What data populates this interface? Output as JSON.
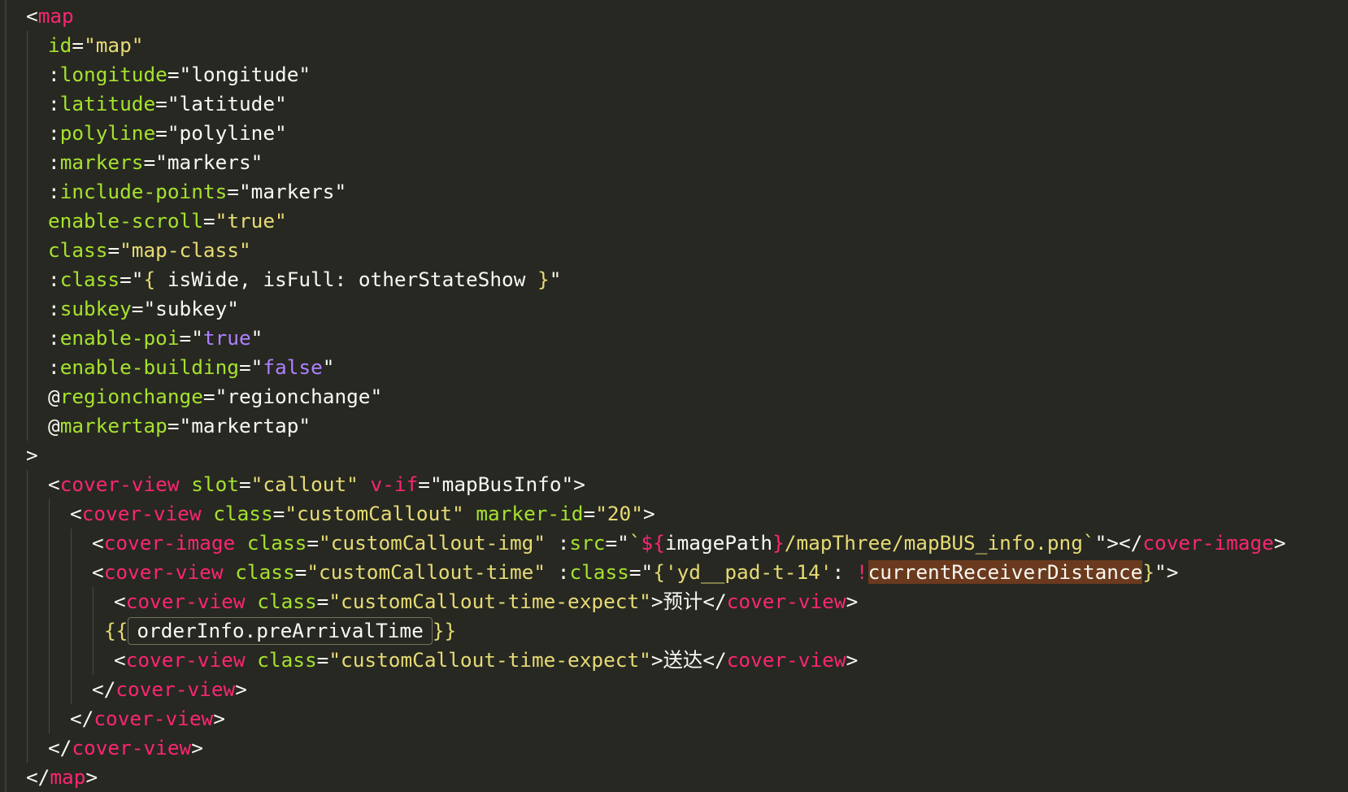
{
  "lines": [
    {
      "indent": 1,
      "guides": 0,
      "tokens": [
        [
          "punc",
          "<"
        ],
        [
          "tag",
          "map"
        ]
      ]
    },
    {
      "indent": 2,
      "guides": 1,
      "tokens": [
        [
          "attr",
          "id"
        ],
        [
          "punc",
          "="
        ],
        [
          "str",
          "\"map\""
        ]
      ]
    },
    {
      "indent": 2,
      "guides": 1,
      "tokens": [
        [
          "punc",
          ":"
        ],
        [
          "attr",
          "longitude"
        ],
        [
          "punc",
          "=\""
        ],
        [
          "plain",
          "longitude"
        ],
        [
          "punc",
          "\""
        ]
      ]
    },
    {
      "indent": 2,
      "guides": 1,
      "tokens": [
        [
          "punc",
          ":"
        ],
        [
          "attr",
          "latitude"
        ],
        [
          "punc",
          "=\""
        ],
        [
          "plain",
          "latitude"
        ],
        [
          "punc",
          "\""
        ]
      ]
    },
    {
      "indent": 2,
      "guides": 1,
      "tokens": [
        [
          "punc",
          ":"
        ],
        [
          "attr",
          "polyline"
        ],
        [
          "punc",
          "=\""
        ],
        [
          "plain",
          "polyline"
        ],
        [
          "punc",
          "\""
        ]
      ]
    },
    {
      "indent": 2,
      "guides": 1,
      "tokens": [
        [
          "punc",
          ":"
        ],
        [
          "attr",
          "markers"
        ],
        [
          "punc",
          "=\""
        ],
        [
          "plain",
          "markers"
        ],
        [
          "punc",
          "\""
        ]
      ]
    },
    {
      "indent": 2,
      "guides": 1,
      "tokens": [
        [
          "punc",
          ":"
        ],
        [
          "attr",
          "include-points"
        ],
        [
          "punc",
          "=\""
        ],
        [
          "plain",
          "markers"
        ],
        [
          "punc",
          "\""
        ]
      ]
    },
    {
      "indent": 2,
      "guides": 1,
      "tokens": [
        [
          "attr",
          "enable-scroll"
        ],
        [
          "punc",
          "="
        ],
        [
          "str",
          "\"true\""
        ]
      ]
    },
    {
      "indent": 2,
      "guides": 1,
      "tokens": [
        [
          "attr",
          "class"
        ],
        [
          "punc",
          "="
        ],
        [
          "str",
          "\"map-class\""
        ]
      ]
    },
    {
      "indent": 2,
      "guides": 1,
      "tokens": [
        [
          "punc",
          ":"
        ],
        [
          "attr",
          "class"
        ],
        [
          "punc",
          "=\""
        ],
        [
          "brace",
          "{"
        ],
        [
          "plain",
          " isWide, isFull: otherStateShow "
        ],
        [
          "brace",
          "}"
        ],
        [
          "punc",
          "\""
        ]
      ]
    },
    {
      "indent": 2,
      "guides": 1,
      "tokens": [
        [
          "punc",
          ":"
        ],
        [
          "attr",
          "subkey"
        ],
        [
          "punc",
          "=\""
        ],
        [
          "plain",
          "subkey"
        ],
        [
          "punc",
          "\""
        ]
      ]
    },
    {
      "indent": 2,
      "guides": 1,
      "tokens": [
        [
          "punc",
          ":"
        ],
        [
          "attr",
          "enable-poi"
        ],
        [
          "punc",
          "=\""
        ],
        [
          "bool",
          "true"
        ],
        [
          "punc",
          "\""
        ]
      ]
    },
    {
      "indent": 2,
      "guides": 1,
      "tokens": [
        [
          "punc",
          ":"
        ],
        [
          "attr",
          "enable-building"
        ],
        [
          "punc",
          "=\""
        ],
        [
          "bool",
          "false"
        ],
        [
          "punc",
          "\""
        ]
      ]
    },
    {
      "indent": 2,
      "guides": 1,
      "tokens": [
        [
          "punc",
          "@"
        ],
        [
          "attr",
          "regionchange"
        ],
        [
          "punc",
          "=\""
        ],
        [
          "plain",
          "regionchange"
        ],
        [
          "punc",
          "\""
        ]
      ]
    },
    {
      "indent": 2,
      "guides": 1,
      "tokens": [
        [
          "punc",
          "@"
        ],
        [
          "attr",
          "markertap"
        ],
        [
          "punc",
          "=\""
        ],
        [
          "plain",
          "markertap"
        ],
        [
          "punc",
          "\""
        ]
      ]
    },
    {
      "indent": 1,
      "guides": 0,
      "tokens": [
        [
          "punc",
          ">"
        ]
      ]
    },
    {
      "indent": 2,
      "guides": 1,
      "tokens": [
        [
          "punc",
          "<"
        ],
        [
          "tag",
          "cover-view"
        ],
        [
          "plain",
          " "
        ],
        [
          "attr",
          "slot"
        ],
        [
          "punc",
          "="
        ],
        [
          "str",
          "\"callout\""
        ],
        [
          "plain",
          " "
        ],
        [
          "tag",
          "v-if"
        ],
        [
          "punc",
          "=\""
        ],
        [
          "plain",
          "mapBusInfo"
        ],
        [
          "punc",
          "\">"
        ]
      ]
    },
    {
      "indent": 3,
      "guides": 2,
      "tokens": [
        [
          "punc",
          "<"
        ],
        [
          "tag",
          "cover-view"
        ],
        [
          "plain",
          " "
        ],
        [
          "attr",
          "class"
        ],
        [
          "punc",
          "="
        ],
        [
          "str",
          "\"customCallout\""
        ],
        [
          "plain",
          " "
        ],
        [
          "attr",
          "marker-id"
        ],
        [
          "punc",
          "="
        ],
        [
          "str",
          "\"20\""
        ],
        [
          "punc",
          ">"
        ]
      ]
    },
    {
      "indent": 4,
      "guides": 3,
      "tokens": [
        [
          "punc",
          "<"
        ],
        [
          "tag",
          "cover-image"
        ],
        [
          "plain",
          " "
        ],
        [
          "attr",
          "class"
        ],
        [
          "punc",
          "="
        ],
        [
          "str",
          "\"customCallout-img\""
        ],
        [
          "plain",
          " "
        ],
        [
          "punc",
          ":"
        ],
        [
          "attr",
          "src"
        ],
        [
          "punc",
          "=\""
        ],
        [
          "str",
          "`"
        ],
        [
          "tag",
          "${"
        ],
        [
          "plain",
          "imagePath"
        ],
        [
          "tag",
          "}"
        ],
        [
          "str",
          "/mapThree/mapBUS_info.png`"
        ],
        [
          "punc",
          "\"></"
        ],
        [
          "tag",
          "cover-image"
        ],
        [
          "punc",
          ">"
        ]
      ]
    },
    {
      "indent": 4,
      "guides": 3,
      "tokens": [
        [
          "punc",
          "<"
        ],
        [
          "tag",
          "cover-view"
        ],
        [
          "plain",
          " "
        ],
        [
          "attr",
          "class"
        ],
        [
          "punc",
          "="
        ],
        [
          "str",
          "\"customCallout-time\""
        ],
        [
          "plain",
          " "
        ],
        [
          "punc",
          ":"
        ],
        [
          "attr",
          "class"
        ],
        [
          "punc",
          "=\""
        ],
        [
          "brace",
          "{"
        ],
        [
          "str",
          "'yd__pad-t-14'"
        ],
        [
          "plain",
          ": "
        ],
        [
          "tag",
          "!"
        ],
        [
          "hl",
          "currentReceiverDistance"
        ],
        [
          "brace",
          "}"
        ],
        [
          "punc",
          "\">"
        ]
      ]
    },
    {
      "indent": 5,
      "guides": 4,
      "tokens": [
        [
          "punc",
          "<"
        ],
        [
          "tag",
          "cover-view"
        ],
        [
          "plain",
          " "
        ],
        [
          "attr",
          "class"
        ],
        [
          "punc",
          "="
        ],
        [
          "str",
          "\"customCallout-time-expect\""
        ],
        [
          "punc",
          ">"
        ],
        [
          "cjk",
          "预计"
        ],
        [
          "punc",
          "</"
        ],
        [
          "tag",
          "cover-view"
        ],
        [
          "punc",
          ">"
        ]
      ]
    },
    {
      "indent": 4.55,
      "guides": 4,
      "tokens": [
        [
          "brace",
          "{{"
        ],
        [
          "hint",
          "orderInfo.preArrivalTime"
        ],
        [
          "brace",
          "}}"
        ]
      ]
    },
    {
      "indent": 5,
      "guides": 4,
      "tokens": [
        [
          "punc",
          "<"
        ],
        [
          "tag",
          "cover-view"
        ],
        [
          "plain",
          " "
        ],
        [
          "attr",
          "class"
        ],
        [
          "punc",
          "="
        ],
        [
          "str",
          "\"customCallout-time-expect\""
        ],
        [
          "punc",
          ">"
        ],
        [
          "cjk",
          "送达"
        ],
        [
          "punc",
          "</"
        ],
        [
          "tag",
          "cover-view"
        ],
        [
          "punc",
          ">"
        ]
      ]
    },
    {
      "indent": 4,
      "guides": 3,
      "tokens": [
        [
          "punc",
          "</"
        ],
        [
          "tag",
          "cover-view"
        ],
        [
          "punc",
          ">"
        ]
      ]
    },
    {
      "indent": 3,
      "guides": 2,
      "tokens": [
        [
          "punc",
          "</"
        ],
        [
          "tag",
          "cover-view"
        ],
        [
          "punc",
          ">"
        ]
      ]
    },
    {
      "indent": 2,
      "guides": 1,
      "tokens": [
        [
          "punc",
          "</"
        ],
        [
          "tag",
          "cover-view"
        ],
        [
          "punc",
          ">"
        ]
      ]
    },
    {
      "indent": 1,
      "guides": 0,
      "tokens": [
        [
          "punc",
          "</"
        ],
        [
          "tag",
          "map"
        ],
        [
          "punc",
          ">"
        ]
      ]
    }
  ]
}
